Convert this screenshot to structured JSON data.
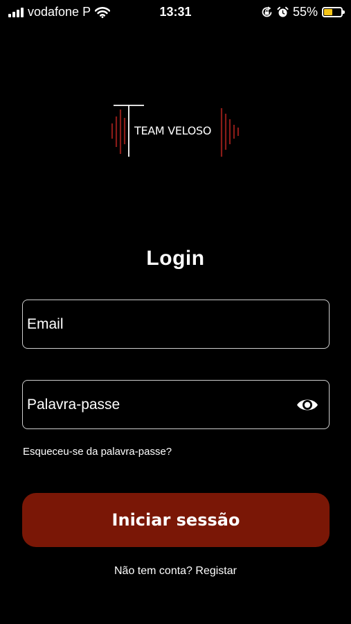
{
  "status_bar": {
    "carrier": "vodafone P",
    "time": "13:31",
    "battery_percent": "55%",
    "battery_level": 0.55,
    "battery_color": "#f5c518"
  },
  "brand": {
    "logo_text": "TEAM VELOSO",
    "accent_color": "#7a1706"
  },
  "login": {
    "title": "Login",
    "email_placeholder": "Email",
    "password_placeholder": "Palavra-passe",
    "forgot_password": "Esqueceu-se da palavra-passe?",
    "submit_label": "Iniciar sessão",
    "register_prompt": "Não tem conta? Registar"
  },
  "icons": {
    "password_toggle": "eye-icon",
    "wifi": "wifi-icon",
    "signal": "cellular-signal-icon",
    "orientation_lock": "orientation-lock-icon",
    "alarm": "alarm-clock-icon",
    "battery": "battery-icon"
  }
}
